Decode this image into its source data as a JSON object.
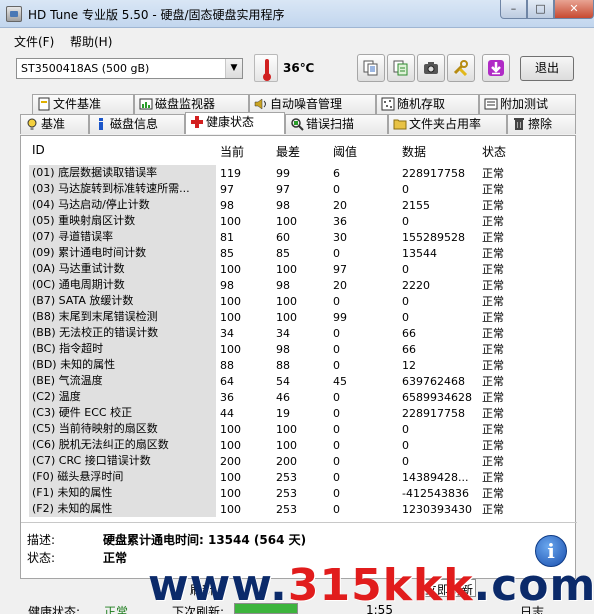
{
  "window": {
    "title": "HD Tune 专业版 5.50 - 硬盘/固态硬盘实用程序"
  },
  "menu": [
    {
      "label": "文件(F)"
    },
    {
      "label": "帮助(H)"
    }
  ],
  "toolbar": {
    "drive": "ST3500418AS (500 gB)",
    "temperature": "36℃",
    "exit_label": "退出",
    "icons": [
      "copy-icon",
      "copy-green-icon",
      "camera-icon",
      "tools-icon",
      "download-icon"
    ]
  },
  "tabs_top": [
    {
      "label": "文件基准",
      "icon": "file-benchmark-icon"
    },
    {
      "label": "磁盘监视器",
      "icon": "monitor-icon"
    },
    {
      "label": "自动噪音管理",
      "icon": "speaker-icon"
    },
    {
      "label": "随机存取",
      "icon": "random-access-icon"
    },
    {
      "label": "附加测试",
      "icon": "extra-tests-icon"
    }
  ],
  "tabs_bottom": [
    {
      "label": "基准",
      "icon": "benchmark-icon"
    },
    {
      "label": "磁盘信息",
      "icon": "info-icon"
    },
    {
      "label": "健康状态",
      "icon": "health-cross-icon",
      "active": true
    },
    {
      "label": "错误扫描",
      "icon": "error-scan-icon"
    },
    {
      "label": "文件夹占用率",
      "icon": "folder-icon"
    },
    {
      "label": "擦除",
      "icon": "trash-icon"
    }
  ],
  "table": {
    "headers": [
      "ID",
      "当前",
      "最差",
      "阈值",
      "数据",
      "状态"
    ],
    "rows": [
      {
        "id": "(01) 底层数据读取错误率",
        "current": "119",
        "worst": "99",
        "threshold": "6",
        "data": "228917758",
        "status": "正常"
      },
      {
        "id": "(03) 马达旋转到标准转速所需...",
        "current": "97",
        "worst": "97",
        "threshold": "0",
        "data": "0",
        "status": "正常"
      },
      {
        "id": "(04) 马达启动/停止计数",
        "current": "98",
        "worst": "98",
        "threshold": "20",
        "data": "2155",
        "status": "正常"
      },
      {
        "id": "(05) 重映射扇区计数",
        "current": "100",
        "worst": "100",
        "threshold": "36",
        "data": "0",
        "status": "正常"
      },
      {
        "id": "(07) 寻道错误率",
        "current": "81",
        "worst": "60",
        "threshold": "30",
        "data": "155289528",
        "status": "正常"
      },
      {
        "id": "(09) 累计通电时间计数",
        "current": "85",
        "worst": "85",
        "threshold": "0",
        "data": "13544",
        "status": "正常"
      },
      {
        "id": "(0A) 马达重试计数",
        "current": "100",
        "worst": "100",
        "threshold": "97",
        "data": "0",
        "status": "正常"
      },
      {
        "id": "(0C) 通电周期计数",
        "current": "98",
        "worst": "98",
        "threshold": "20",
        "data": "2220",
        "status": "正常"
      },
      {
        "id": "(B7) SATA 放缓计数",
        "current": "100",
        "worst": "100",
        "threshold": "0",
        "data": "0",
        "status": "正常"
      },
      {
        "id": "(B8) 末尾到末尾错误检测",
        "current": "100",
        "worst": "100",
        "threshold": "99",
        "data": "0",
        "status": "正常"
      },
      {
        "id": "(BB) 无法校正的错误计数",
        "current": "34",
        "worst": "34",
        "threshold": "0",
        "data": "66",
        "status": "正常"
      },
      {
        "id": "(BC) 指令超时",
        "current": "100",
        "worst": "98",
        "threshold": "0",
        "data": "66",
        "status": "正常"
      },
      {
        "id": "(BD) 未知的属性",
        "current": "88",
        "worst": "88",
        "threshold": "0",
        "data": "12",
        "status": "正常"
      },
      {
        "id": "(BE) 气流温度",
        "current": "64",
        "worst": "54",
        "threshold": "45",
        "data": "639762468",
        "status": "正常"
      },
      {
        "id": "(C2) 温度",
        "current": "36",
        "worst": "46",
        "threshold": "0",
        "data": "6589934628",
        "status": "正常"
      },
      {
        "id": "(C3) 硬件 ECC 校正",
        "current": "44",
        "worst": "19",
        "threshold": "0",
        "data": "228917758",
        "status": "正常"
      },
      {
        "id": "(C5) 当前待映射的扇区数",
        "current": "100",
        "worst": "100",
        "threshold": "0",
        "data": "0",
        "status": "正常"
      },
      {
        "id": "(C6) 脱机无法纠正的扇区数",
        "current": "100",
        "worst": "100",
        "threshold": "0",
        "data": "0",
        "status": "正常"
      },
      {
        "id": "(C7) CRC 接口错误计数",
        "current": "200",
        "worst": "200",
        "threshold": "0",
        "data": "0",
        "status": "正常"
      },
      {
        "id": "(F0) 磁头悬浮时间",
        "current": "100",
        "worst": "253",
        "threshold": "0",
        "data": "14389428...",
        "status": "正常"
      },
      {
        "id": "(F1) 未知的属性",
        "current": "100",
        "worst": "253",
        "threshold": "0",
        "data": "-412543836",
        "status": "正常"
      },
      {
        "id": "(F2) 未知的属性",
        "current": "100",
        "worst": "253",
        "threshold": "0",
        "data": "1230393430",
        "status": "正常"
      }
    ]
  },
  "details": {
    "desc_label": "描述:",
    "desc_value": "硬盘累计通电时间: 13544 (564 天)",
    "state_label": "状态:",
    "state_value": "正常"
  },
  "bottom": {
    "refresh_partial": "刷新",
    "refresh_now": "立即刷新",
    "health_label": "健康状态:",
    "health_value": "正常",
    "next_refresh_label": "下次刷新:",
    "timer": "1:55",
    "log_label": "日志"
  },
  "watermark": {
    "text_a": "www.",
    "text_b": "315kkk",
    "text_c": ".com"
  }
}
